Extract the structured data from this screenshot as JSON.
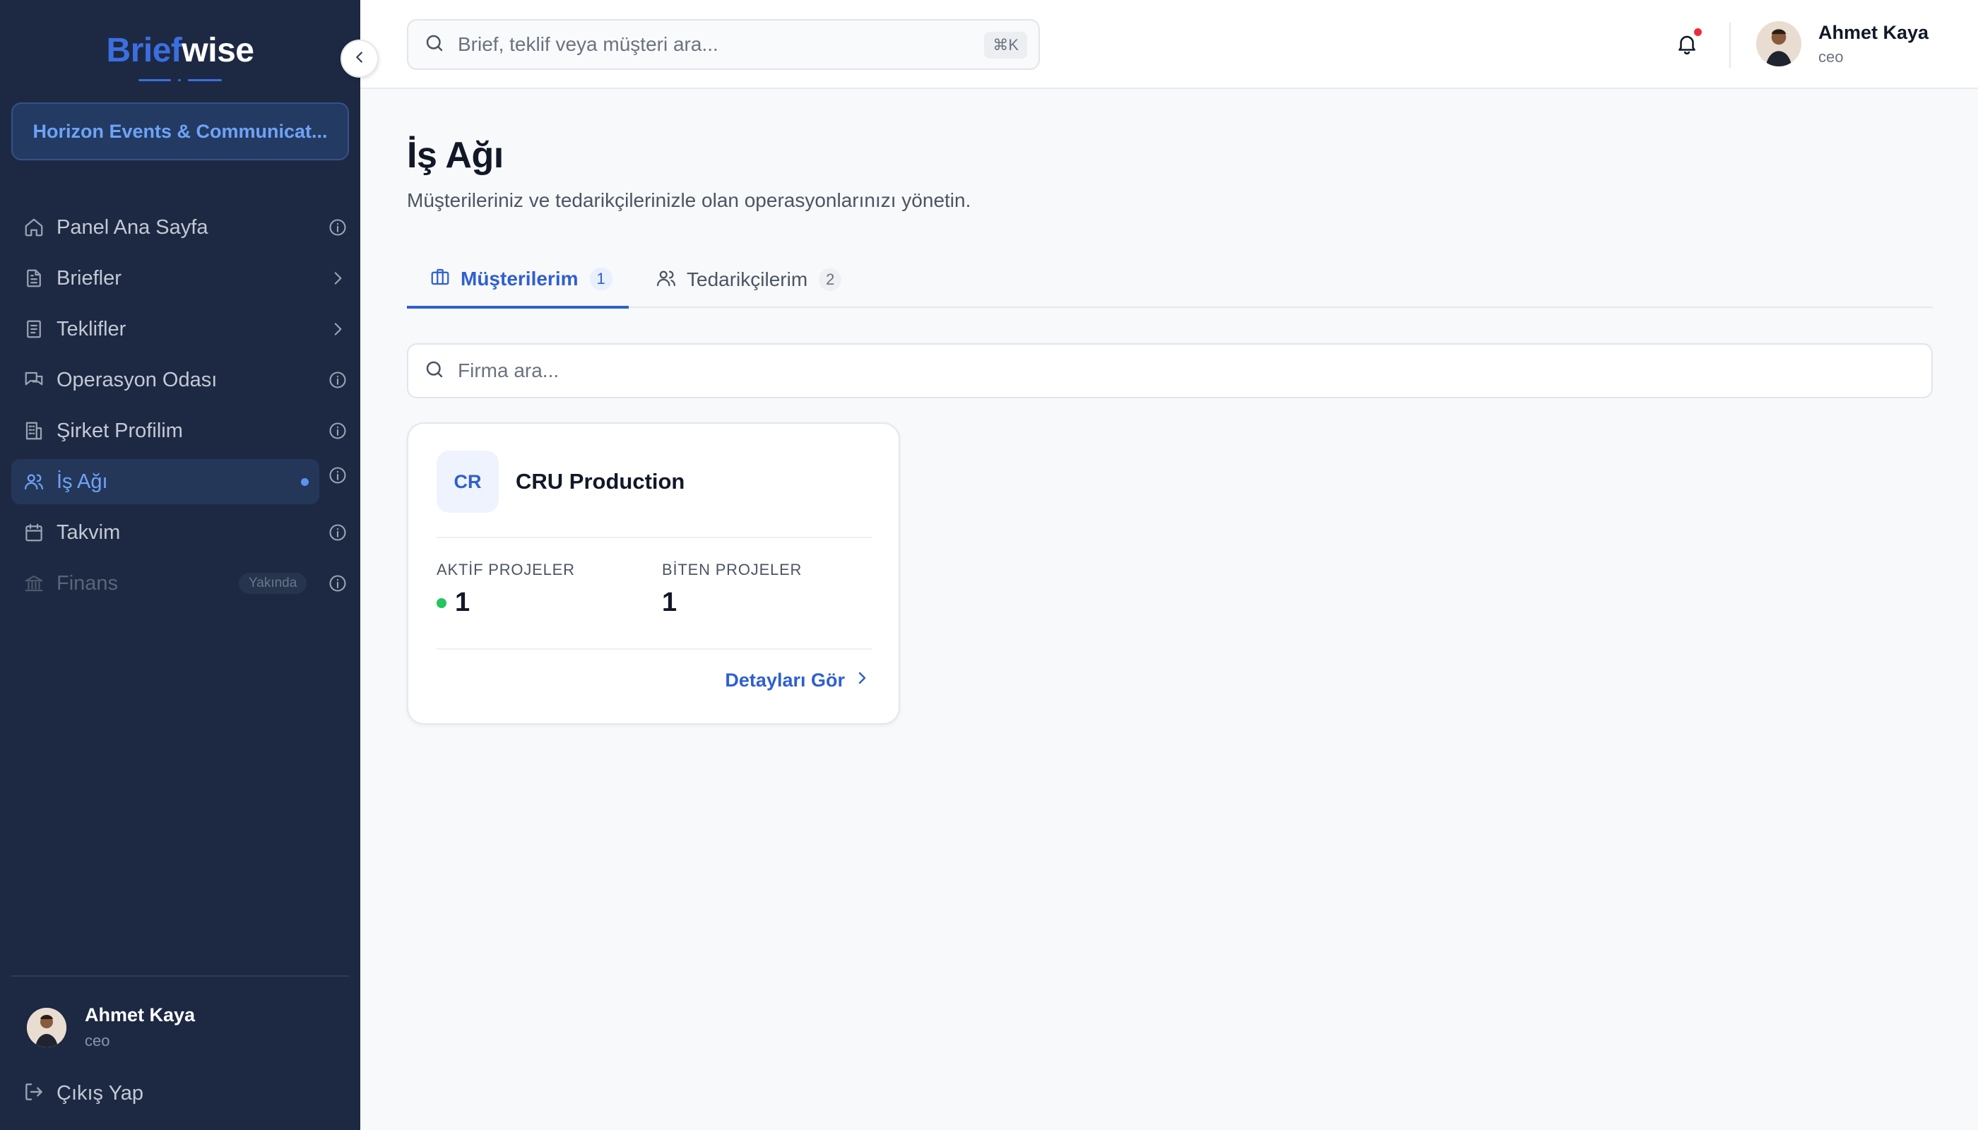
{
  "sidebar": {
    "logo": {
      "part1": "Brief",
      "part2": "wise"
    },
    "company": "Horizon Events & Communicat...",
    "items": [
      {
        "label": "Panel Ana Sayfa",
        "icon": "home-icon",
        "right": "info-icon"
      },
      {
        "label": "Briefler",
        "icon": "file-text-icon",
        "right": "chevron-right-icon"
      },
      {
        "label": "Teklifler",
        "icon": "receipt-icon",
        "right": "chevron-right-icon"
      },
      {
        "label": "Operasyon Odası",
        "icon": "chat-bubbles-icon",
        "right": "info-icon"
      },
      {
        "label": "Şirket Profilim",
        "icon": "building-icon",
        "right": "info-icon"
      },
      {
        "label": "İş Ağı",
        "icon": "users-icon",
        "right": "info-icon",
        "active": true
      },
      {
        "label": "Takvim",
        "icon": "calendar-icon",
        "right": "info-icon"
      },
      {
        "label": "Finans",
        "icon": "bank-icon",
        "right": "info-icon",
        "badge": "Yakında",
        "disabled": true
      }
    ],
    "user": {
      "name": "Ahmet Kaya",
      "role": "ceo"
    },
    "logout": "Çıkış Yap"
  },
  "header": {
    "search_placeholder": "Brief, teklif veya müşteri ara...",
    "shortcut": "⌘K",
    "user": {
      "name": "Ahmet Kaya",
      "role": "ceo"
    }
  },
  "main": {
    "title": "İş Ağı",
    "subtitle": "Müşterileriniz ve tedarikçilerinizle olan operasyonlarınızı yönetin.",
    "tabs": [
      {
        "label": "Müşterilerim",
        "count": "1",
        "icon": "briefcase-icon"
      },
      {
        "label": "Tedarikçilerim",
        "count": "2",
        "icon": "users-icon"
      }
    ],
    "firm_search_placeholder": "Firma ara...",
    "cards": [
      {
        "initials": "CR",
        "name": "CRU Production",
        "active_label": "AKTİF PROJELER",
        "active_value": "1",
        "done_label": "BİTEN PROJELER",
        "done_value": "1",
        "link": "Detayları Gör"
      }
    ]
  },
  "colors": {
    "sidebar_bg": "#1d2943",
    "accent": "#2f5fd0",
    "active_nav_text": "#6ea3f5",
    "notification": "#ef2b3b",
    "active_dot": "#22c55e"
  }
}
